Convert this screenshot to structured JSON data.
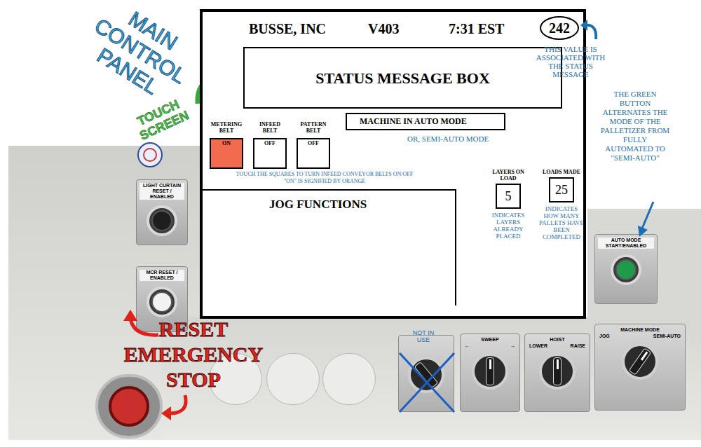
{
  "annotations": {
    "title": "MAIN CONTROL PANEL",
    "touch_screen": "TOUCH SCREEN",
    "status_value_note": "THIS VALUE IS ASSOCIATED WITH THE STATUS MESSAGE",
    "mode_alt": "OR, SEMI-AUTO MODE",
    "belt_note": "TOUCH THE SQUARES TO TURN INFEED CONVEYOR BELTS ON/OFF",
    "on_note": "\"ON\" IS SIGNIFIED BY ORANGE",
    "green_button_note": "THE GREEN BUTTON ALTERNATES THE MODE OF THE PALLETIZER FROM FULLY AUTOMATED TO \"SEMI-AUTO\"",
    "reset_note": "RESET EMERGENCY STOP",
    "not_in_use": "NOT IN USE"
  },
  "screen": {
    "company": "BUSSE, INC",
    "version": "V403",
    "time": "7:31 EST",
    "status_value": "242",
    "status_message": "STATUS MESSAGE BOX",
    "mode": "MACHINE IN AUTO MODE",
    "belts": [
      {
        "label": "METERING BELT",
        "state": "ON",
        "on": true
      },
      {
        "label": "INFEED BELT",
        "state": "OFF",
        "on": false
      },
      {
        "label": "PATTERN BELT",
        "state": "OFF",
        "on": false
      }
    ],
    "jog_title": "JOG FUNCTIONS",
    "counters": [
      {
        "label": "LAYERS ON LOAD",
        "value": "5",
        "note": "INDICATES LAYERS ALREADY PLACED"
      },
      {
        "label": "LOADS MADE",
        "value": "25",
        "note": "INDICATES HOW MANY PALLETS HAVE BEEN COMPLETED"
      }
    ]
  },
  "panel": {
    "buttons": [
      {
        "label": "LIGHT CURTAIN RESET / ENABLED",
        "color": "#1e1e1e"
      },
      {
        "label": "MCR RESET / ENABLED",
        "color": "#f2f2f2"
      },
      {
        "label": "AUTO MODE START/ENABLED",
        "color": "#1f9a4a"
      }
    ],
    "switches": [
      {
        "label": "SWEEP",
        "left": "←",
        "right": "→",
        "position": "center"
      },
      {
        "label": "HOIST",
        "left": "LOWER",
        "right": "RAISE",
        "position": "center"
      },
      {
        "label": "MACHINE MODE",
        "left": "JOG",
        "right": "SEMI-AUTO",
        "position": "right"
      }
    ]
  }
}
